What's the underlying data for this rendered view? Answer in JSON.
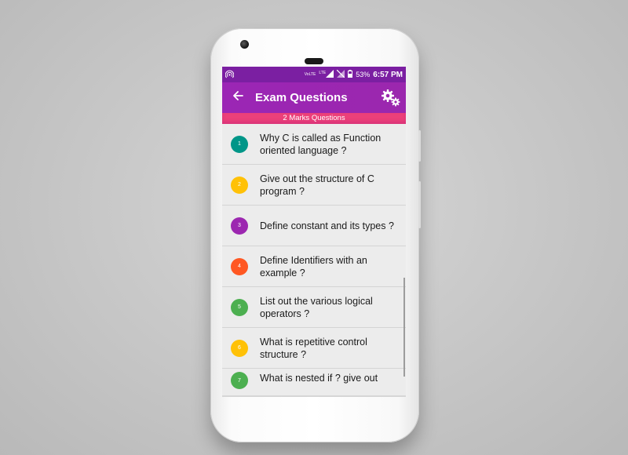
{
  "status_bar": {
    "network_label": "VoLTE",
    "lte_label": "LTE",
    "battery_percent": "53%",
    "time": "6:57 PM"
  },
  "app_bar": {
    "title": "Exam Questions"
  },
  "section_header": "2 Marks Questions",
  "questions": [
    {
      "number": "1",
      "text": "Why C is called as Function oriented language ?",
      "color": "#009688"
    },
    {
      "number": "2",
      "text": "Give out the structure of C program ?",
      "color": "#ffc107"
    },
    {
      "number": "3",
      "text": "Define constant and its types ?",
      "color": "#9c27b0"
    },
    {
      "number": "4",
      "text": "Define Identifiers with an example ?",
      "color": "#ff5722"
    },
    {
      "number": "5",
      "text": "List out the various logical operators ?",
      "color": "#4caf50"
    },
    {
      "number": "6",
      "text": "What is repetitive control structure ?",
      "color": "#ffc107"
    },
    {
      "number": "7",
      "text": "What is nested if ? give out",
      "color": "#4caf50"
    }
  ],
  "colors": {
    "status_bar": "#7b1fa2",
    "app_bar": "#9b27ae",
    "section_header": "#ec407a",
    "list_background": "#ececec"
  },
  "icons": {
    "back": "arrow-left-icon",
    "settings": "gears-icon",
    "hotspot": "hotspot-icon",
    "signal": "signal-icon",
    "battery": "battery-icon"
  }
}
